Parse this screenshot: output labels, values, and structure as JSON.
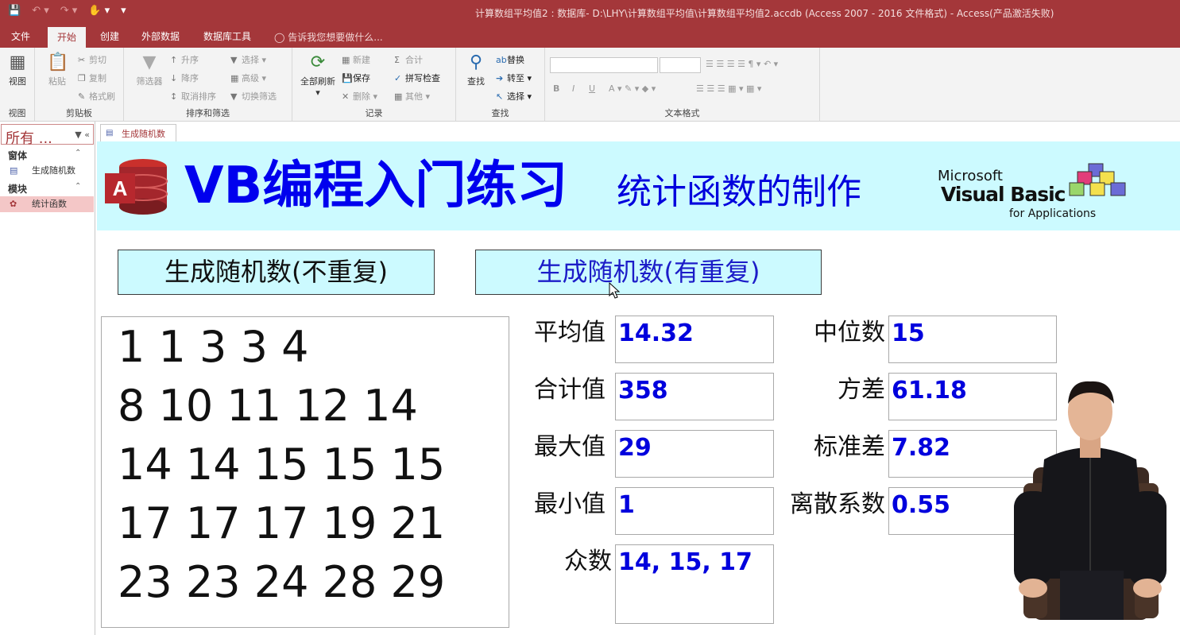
{
  "window": {
    "title": "计算数组平均值2 : 数据库- D:\\LHY\\计算数组平均值\\计算数组平均值2.accdb (Access 2007 - 2016 文件格式) - Access(产品激活失败)"
  },
  "tabs": {
    "file": "文件",
    "home": "开始",
    "create": "创建",
    "external": "外部数据",
    "dbtools": "数据库工具",
    "tellme": "告诉我您想要做什么..."
  },
  "ribbon": {
    "view": {
      "btn": "视图",
      "group": "视图"
    },
    "clipboard": {
      "paste": "粘贴",
      "cut": "剪切",
      "copy": "复制",
      "painter": "格式刷",
      "group": "剪贴板"
    },
    "sort": {
      "filter": "筛选器",
      "asc": "升序",
      "desc": "降序",
      "clear": "取消排序",
      "select": "选择",
      "advanced": "高级",
      "toggle": "切换筛选",
      "group": "排序和筛选"
    },
    "records": {
      "refresh": "全部刷新",
      "new": "新建",
      "save": "保存",
      "delete": "删除",
      "totals": "合计",
      "spell": "拼写检查",
      "more": "其他",
      "group": "记录"
    },
    "find": {
      "find": "查找",
      "replace": "替换",
      "goto": "转至",
      "select": "选择",
      "group": "查找"
    },
    "textfmt": {
      "group": "文本格式"
    }
  },
  "nav": {
    "title": "所有 ...",
    "sections": [
      {
        "label": "窗体",
        "items": [
          "生成随机数"
        ]
      },
      {
        "label": "模块",
        "items": [
          "统计函数"
        ]
      }
    ]
  },
  "doc": {
    "tab": "生成随机数"
  },
  "form": {
    "title": "VB编程入门练习",
    "subtitle": "统计函数的制作",
    "vba": {
      "line1": "Microsoft",
      "line2": "Visual Basic",
      "line3": "for Applications"
    },
    "btn_unique": "生成随机数(不重复)",
    "btn_repeat": "生成随机数(有重复)",
    "numbers": [
      "1 1 3 3 4",
      "8 10 11 12 14",
      "14 14 15 15 15",
      "17 17 17 19 21",
      "23 23 24 28 29"
    ],
    "stats_left": [
      {
        "label": "平均值",
        "value": "14.32"
      },
      {
        "label": "合计值",
        "value": "358"
      },
      {
        "label": "最大值",
        "value": "29"
      },
      {
        "label": "最小值",
        "value": "1"
      },
      {
        "label": "众数",
        "value": "14, 15, 17"
      }
    ],
    "stats_right": [
      {
        "label": "中位数",
        "value": "15"
      },
      {
        "label": "方差",
        "value": "61.18"
      },
      {
        "label": "标准差",
        "value": "7.82"
      },
      {
        "label": "离散系数",
        "value": "0.55"
      }
    ]
  },
  "colors": {
    "accent": "#a4373a",
    "banner": "#ccfaff",
    "value_blue": "#0000dd"
  }
}
